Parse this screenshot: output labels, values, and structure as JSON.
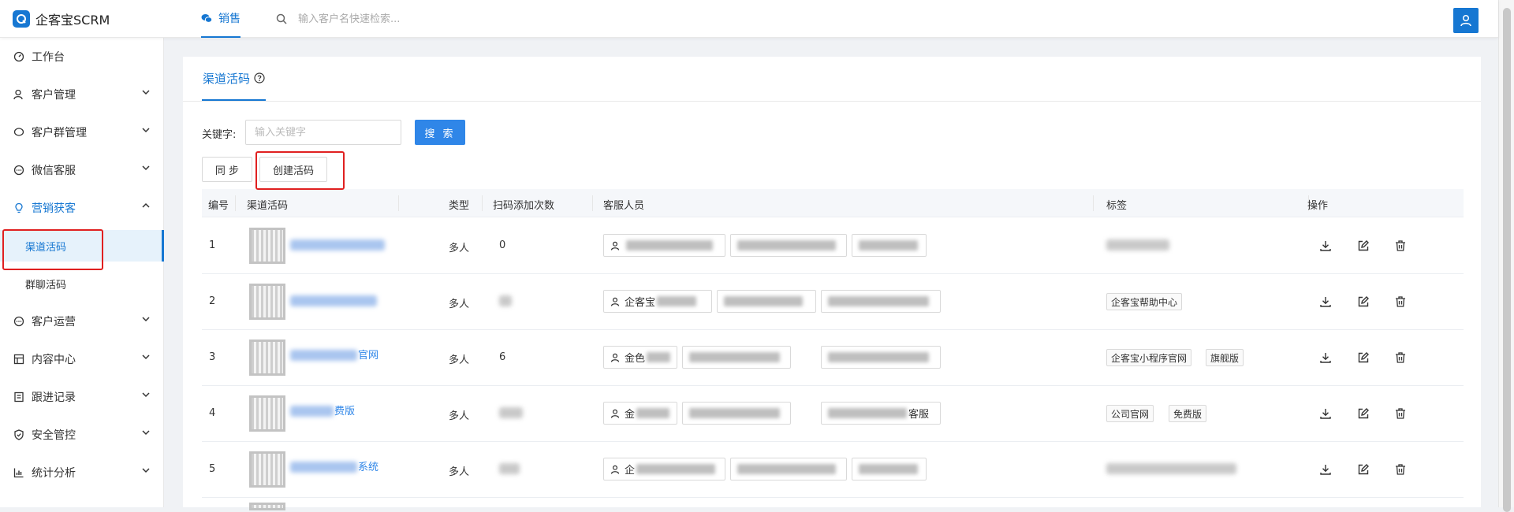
{
  "app": {
    "title": "企客宝SCRM"
  },
  "header": {
    "nav_tab": "销售",
    "search_placeholder": "输入客户名快速检索..."
  },
  "sidebar": {
    "items": [
      {
        "label": "工作台"
      },
      {
        "label": "客户管理"
      },
      {
        "label": "客户群管理"
      },
      {
        "label": "微信客服"
      },
      {
        "label": "营销获客"
      },
      {
        "label": "客户运营"
      },
      {
        "label": "内容中心"
      },
      {
        "label": "跟进记录"
      },
      {
        "label": "安全管控"
      },
      {
        "label": "统计分析"
      }
    ],
    "sub_items": [
      {
        "label": "渠道活码"
      },
      {
        "label": "群聊活码"
      }
    ]
  },
  "page": {
    "tab": "渠道活码",
    "keyword_label": "关键字:",
    "keyword_placeholder": "输入关键字",
    "search_button": "搜 索",
    "sync_button": "同 步",
    "create_button": "创建活码"
  },
  "table": {
    "headers": [
      "编号",
      "渠道活码",
      "类型",
      "扫码添加次数",
      "客服人员",
      "标签",
      "操作"
    ],
    "rows": [
      {
        "id": "1",
        "name_suffix": "",
        "type": "多人",
        "count": "0",
        "staff1": "",
        "tags": []
      },
      {
        "id": "2",
        "name_suffix": "",
        "type": "多人",
        "count": "",
        "staff1": "企客宝",
        "tags": [
          "企客宝帮助中心"
        ]
      },
      {
        "id": "3",
        "name_suffix": "官网",
        "type": "多人",
        "count": "6",
        "staff1": "金色",
        "tags": [
          "企客宝小程序官网",
          "旗舰版"
        ]
      },
      {
        "id": "4",
        "name_suffix": "费版",
        "type": "多人",
        "count": "",
        "staff1": "金",
        "staff3_suffix": "客服",
        "tags": [
          "公司官网",
          "免费版"
        ]
      },
      {
        "id": "5",
        "name_suffix": "系统",
        "type": "多人",
        "count": "",
        "staff1": "企",
        "tags": []
      }
    ]
  },
  "colors": {
    "accent": "#1677d2",
    "highlight": "#e02020"
  },
  "icons": [
    "logo-icon",
    "chat-icon",
    "search-icon",
    "user-icon",
    "download-icon",
    "edit-icon",
    "delete-icon",
    "help-icon"
  ]
}
